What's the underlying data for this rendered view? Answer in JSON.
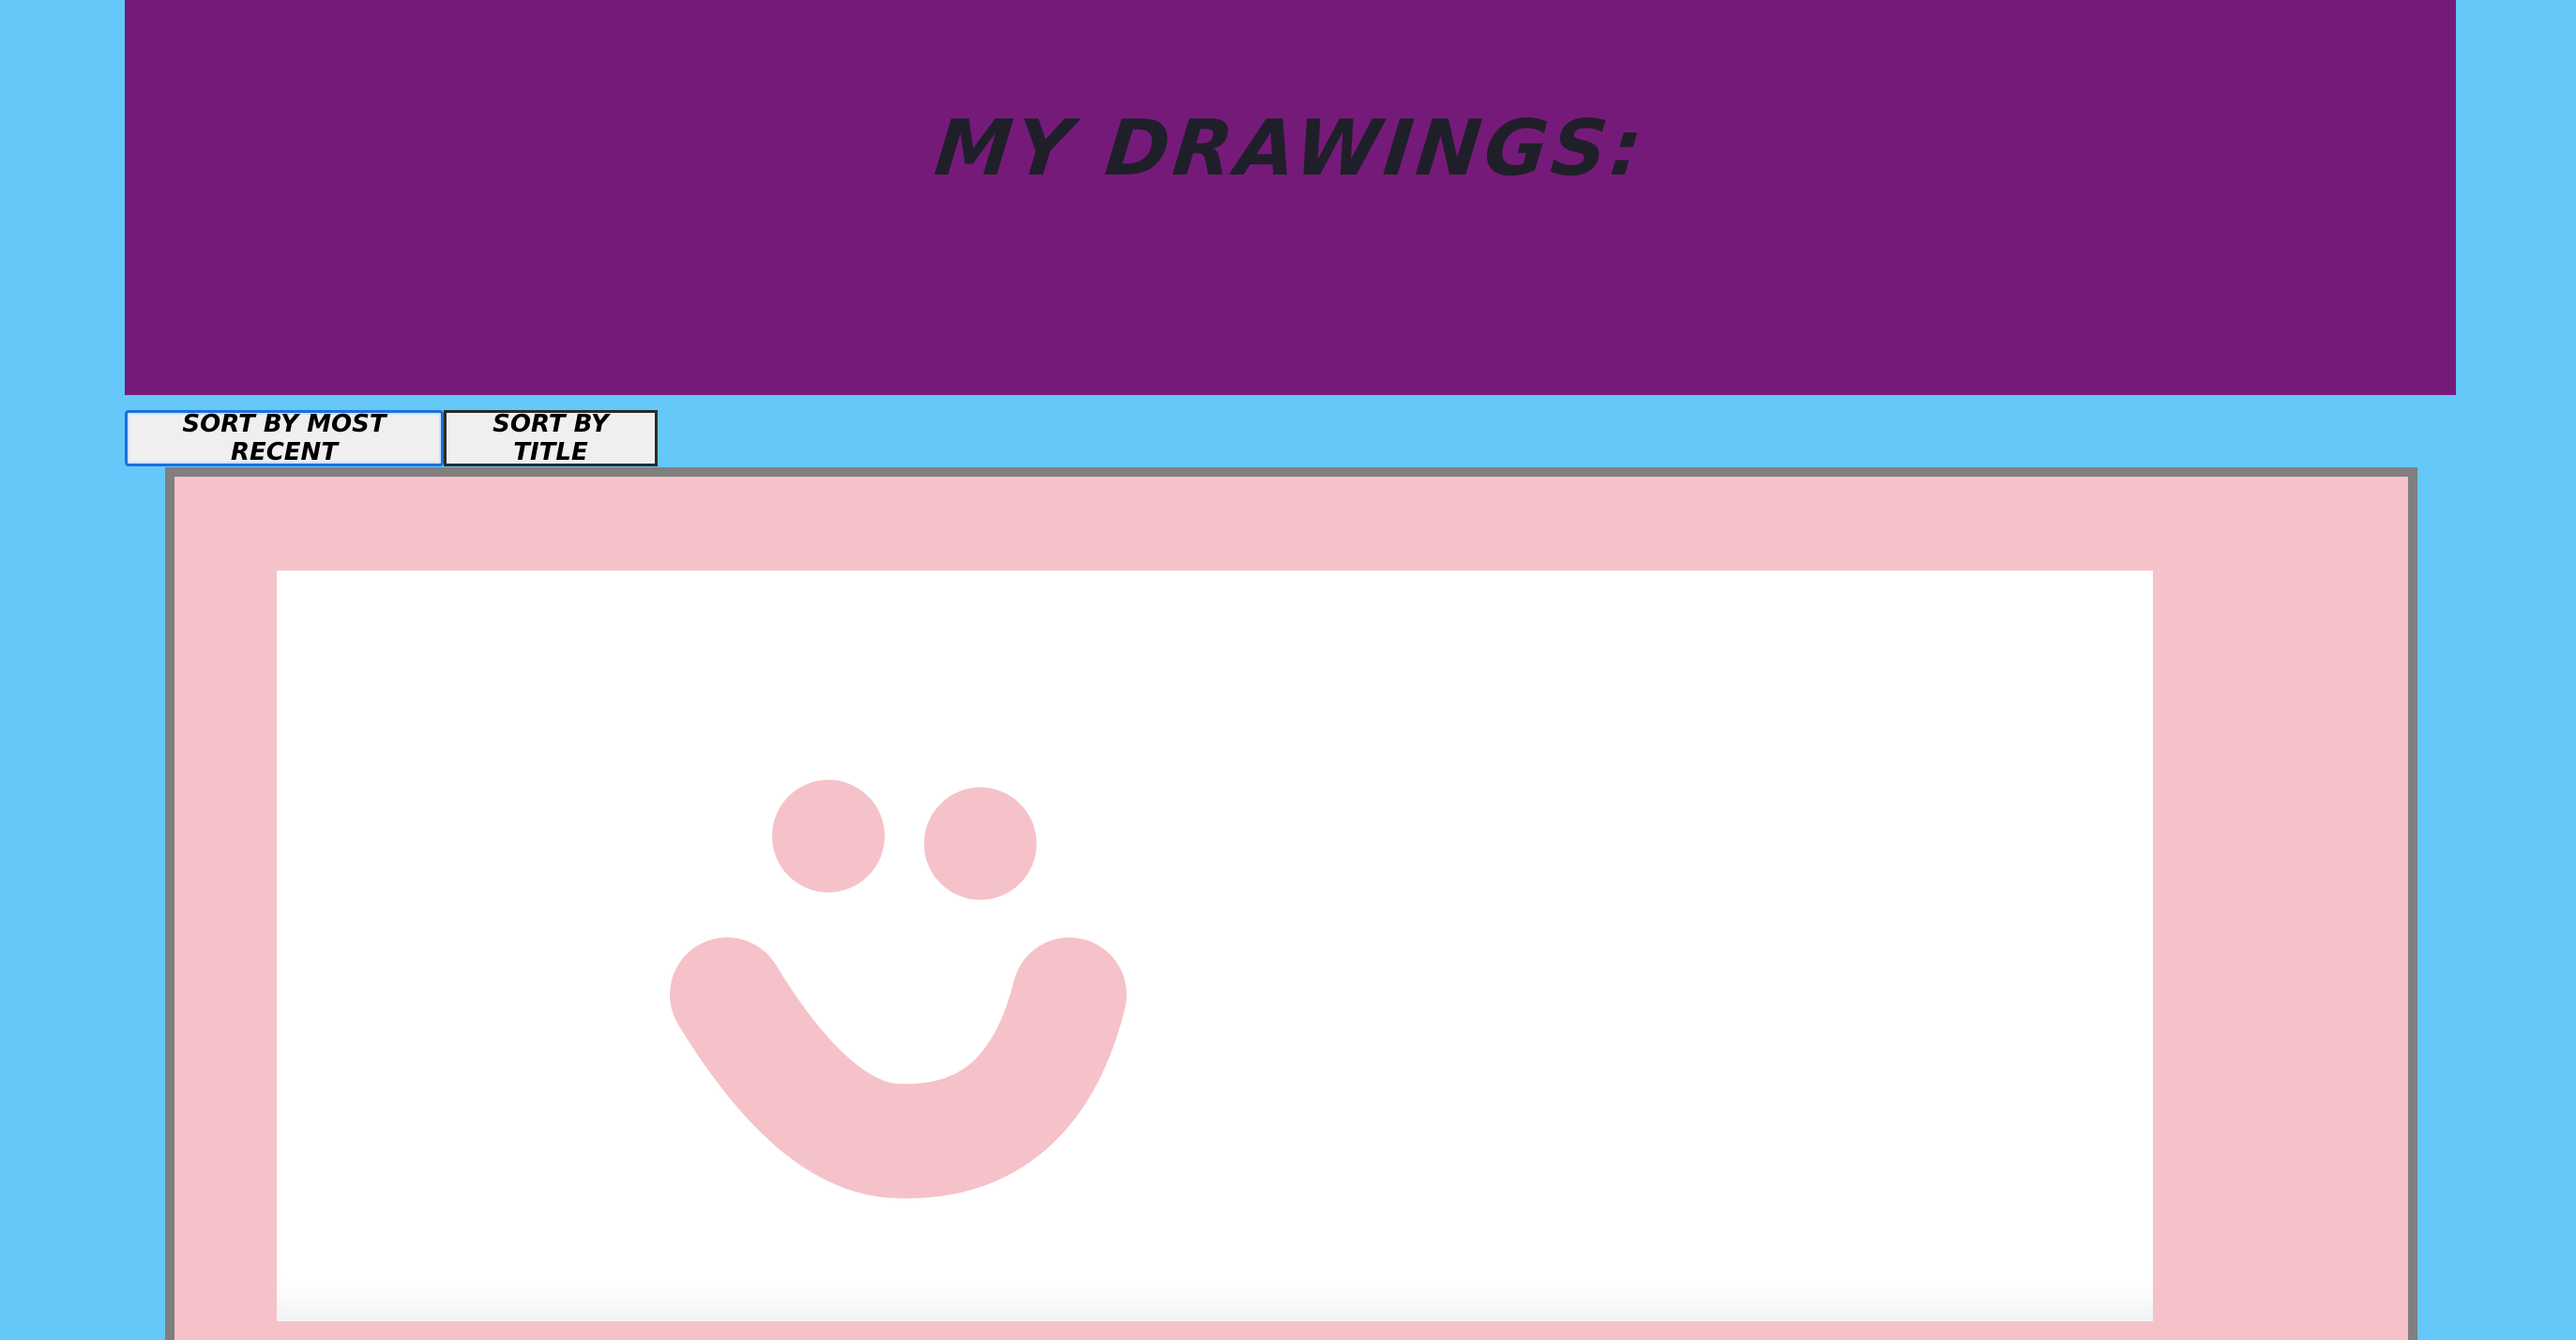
{
  "header": {
    "title": "My Drawings:"
  },
  "sort": {
    "most_recent_label": "Sort By Most Recent",
    "title_label": "Sort By Title"
  },
  "colors": {
    "background": "#66c7f9",
    "header": "#761a7a",
    "card": "#f5c2c9",
    "card_border": "#7f7f7f",
    "drawing_stroke": "#f5c2c9"
  },
  "drawing": {
    "icon": "smiley-face"
  }
}
